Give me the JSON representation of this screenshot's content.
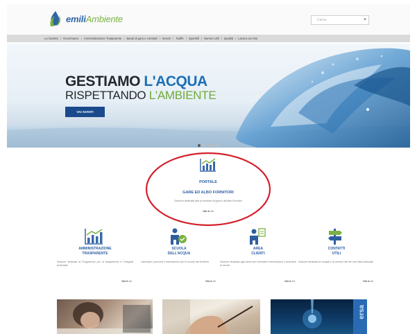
{
  "header": {
    "logo": {
      "part1": "emili",
      "part2": "Ambiente"
    },
    "search": {
      "placeholder": "Cerca"
    }
  },
  "nav": {
    "items": [
      "La Società",
      "Governance",
      "Amministrazione Trasparente",
      "Bandi di gara e contratti",
      "Servizi",
      "Tariffe",
      "Sportelli",
      "Numeri Utili",
      "Qualità",
      "Lavora con Noi"
    ]
  },
  "hero": {
    "line1_a": "GESTIAMO ",
    "line1_b": "L'ACQUA",
    "line2_a": "RISPETTANDO ",
    "line2_b": "L'AMBIENTE",
    "button": "VAI AVANTI",
    "slides": 5,
    "active_slide": 1
  },
  "portal": {
    "title": "PORTALE",
    "subtitle": "GARE ED ALBO FORNITORI",
    "description": "Sezione dedicata alle procedure di gara e all'albo Fornitori",
    "more": "VAI A >>"
  },
  "columns": [
    {
      "icon": "chart-icon",
      "title1": "AMMINISTRAZIONE",
      "title2": "TRASPARENTE",
      "description": "Sezione dedicata al Programma per la trasparenza e l'integrità aziendale",
      "more": "VAI A >>"
    },
    {
      "icon": "school-icon",
      "title1": "SCUOLA",
      "title2": "DELL'ACQUA",
      "description": "Laboratori, percorsi e informazioni per le scuole del territorio",
      "more": "VAI A >>"
    },
    {
      "icon": "customer-area-icon",
      "title1": "AREA",
      "title2": "CLIENTI",
      "description": "Sezione dedicata agli utenti per richiedere informazioni e accedere ai servizi",
      "more": "VAI A >>"
    },
    {
      "icon": "signpost-icon",
      "title1": "CONTATTI",
      "title2": "UTILI",
      "description": "Sezione dedicata ai recapiti e ai numeri utili dei vari uffici aziendali",
      "more": "VAI A >>"
    }
  ],
  "thumbnails": {
    "third_label": "ersa"
  },
  "colors": {
    "brand_blue": "#2b5ca2",
    "brand_green": "#6faa39",
    "highlight_red": "#d41f2b",
    "button_blue": "#1a4a8c"
  }
}
